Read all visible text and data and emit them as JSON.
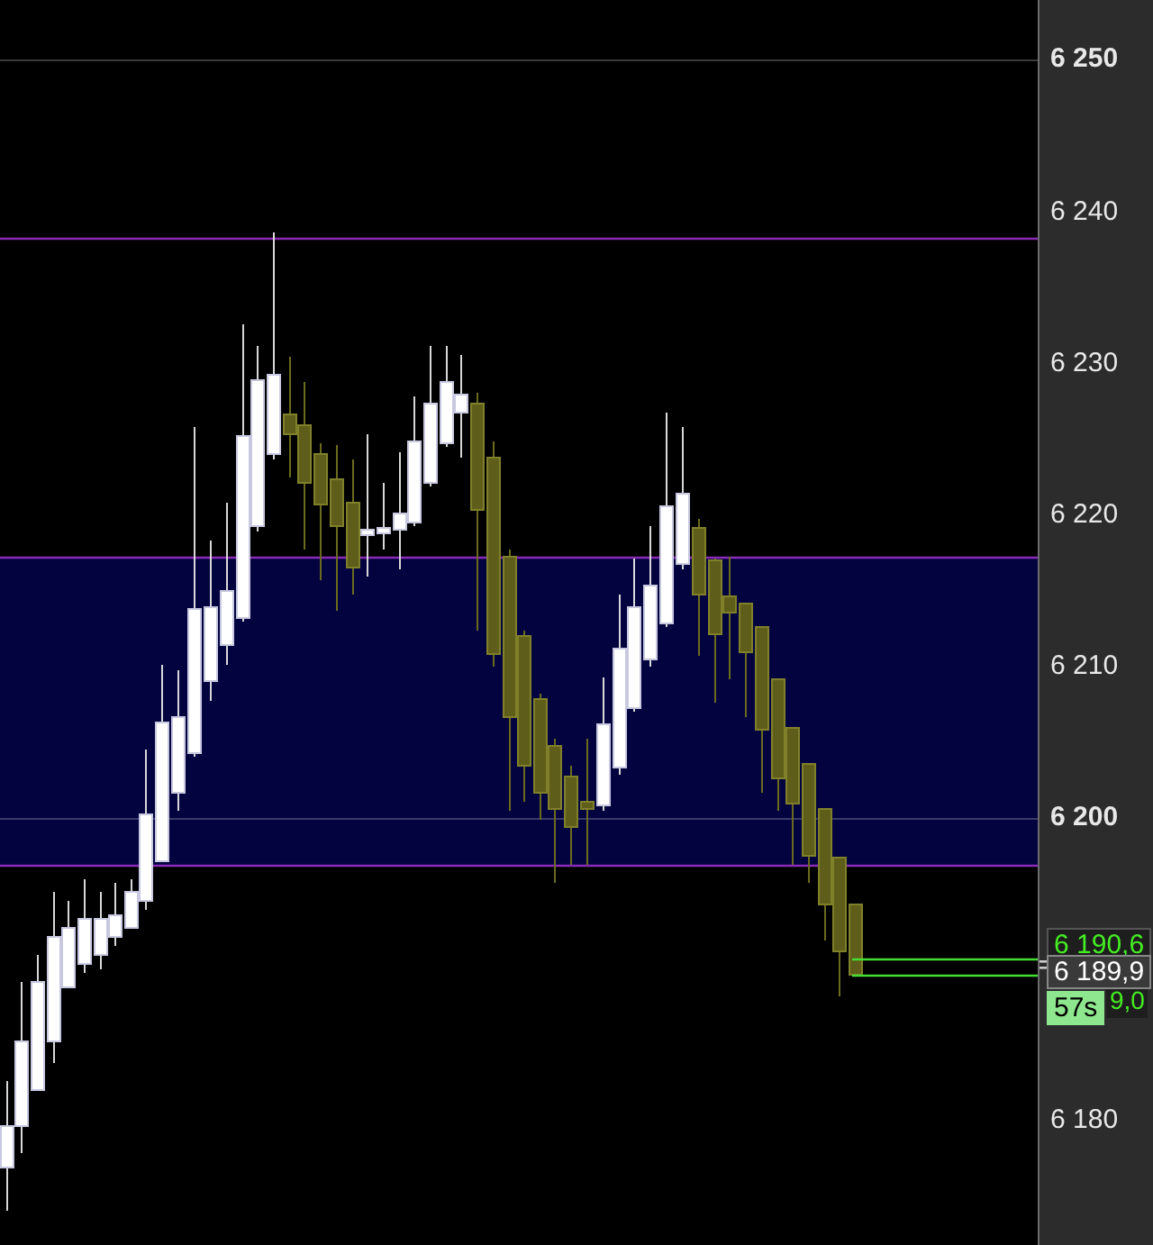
{
  "price_axis": {
    "labels": [
      {
        "text": "6 250",
        "emphasized": true
      },
      {
        "text": "6 240",
        "emphasized": false
      },
      {
        "text": "6 230",
        "emphasized": false
      },
      {
        "text": "6 220",
        "emphasized": false
      },
      {
        "text": "6 210",
        "emphasized": false
      },
      {
        "text": "6 200",
        "emphasized": true
      },
      {
        "text": "6 180",
        "emphasized": false
      }
    ]
  },
  "price_tags": [
    {
      "text": "6 190,6",
      "kind": "ask"
    },
    {
      "text": "6 189,9",
      "kind": "last"
    },
    {
      "text": "57s",
      "kind": "timer"
    },
    {
      "text": "9,0",
      "kind": "bid"
    }
  ]
}
